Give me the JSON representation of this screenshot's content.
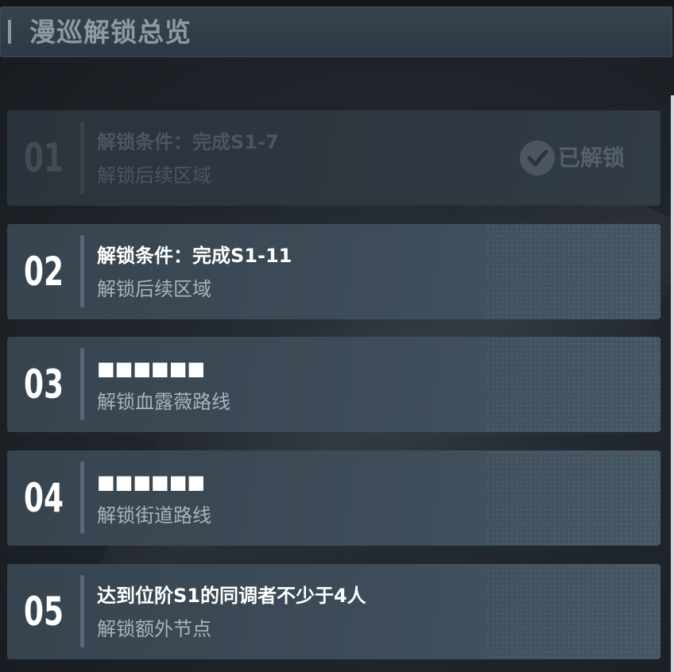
{
  "header": {
    "title": "漫巡解锁总览"
  },
  "cards": [
    {
      "number": "01",
      "condition": "解锁条件：完成S1-7",
      "reward": "解锁后续区域",
      "status_label": "已解锁",
      "state": "unlocked"
    },
    {
      "number": "02",
      "condition": "解锁条件：完成S1-11",
      "reward": "解锁后续区域",
      "state": "locked"
    },
    {
      "number": "03",
      "condition": "■■■■■■",
      "reward": "解锁血露薇路线",
      "state": "locked"
    },
    {
      "number": "04",
      "condition": "■■■■■■",
      "reward": "解锁街道路线",
      "state": "locked"
    },
    {
      "number": "05",
      "condition": "达到位阶S1的同调者不少于4人",
      "reward": "解锁额外节点",
      "state": "locked"
    }
  ],
  "icons": {
    "unlocked": "check-circle-icon"
  },
  "colors": {
    "card_active": "#3d4c58",
    "card_unlocked": "#2e373f",
    "text_primary": "#ffffff",
    "text_secondary": "#a8b3bd"
  }
}
